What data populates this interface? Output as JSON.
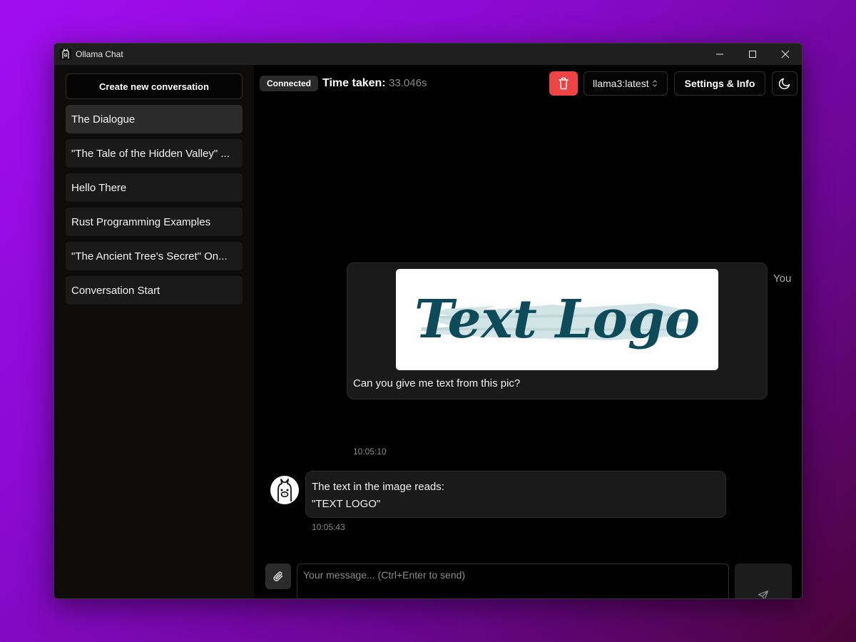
{
  "window": {
    "title": "Ollama Chat"
  },
  "sidebar": {
    "new_conversation_label": "Create new conversation",
    "conversations": [
      {
        "label": "The Dialogue",
        "active": true
      },
      {
        "label": "\"The Tale of the Hidden Valley\" ..."
      },
      {
        "label": "Hello There"
      },
      {
        "label": "Rust Programming Examples"
      },
      {
        "label": "\"The Ancient Tree's Secret\" On..."
      },
      {
        "label": "Conversation Start"
      }
    ]
  },
  "header": {
    "status": "Connected",
    "time_taken_label": "Time taken:",
    "time_taken_value": "33.046s",
    "model": "llama3:latest",
    "settings_label": "Settings & Info",
    "delete_color": "#ef4444"
  },
  "messages": [
    {
      "role": "user",
      "sender_label": "You",
      "image_text": "Text Logo",
      "text": "Can you give me text from this pic?",
      "time": "10:05:10"
    },
    {
      "role": "assistant",
      "text_line1": "The text in the image reads:",
      "text_line2": "\"TEXT LOGO\"",
      "time": "10:05:43"
    }
  ],
  "composer": {
    "placeholder": "Your message... (Ctrl+Enter to send)"
  },
  "icons": [
    "llama-app-icon",
    "minimize-icon",
    "maximize-icon",
    "close-icon",
    "trash-icon",
    "chevron-updown-icon",
    "moon-icon",
    "paperclip-icon",
    "send-icon",
    "llama-avatar-icon"
  ]
}
